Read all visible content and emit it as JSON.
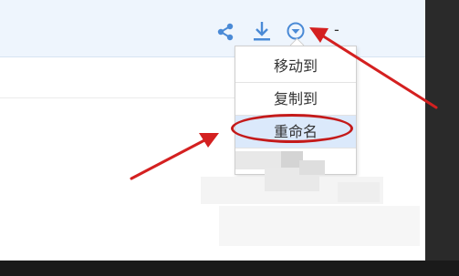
{
  "toolbar": {
    "icons": [
      "share-icon",
      "download-icon",
      "more-dropdown-icon"
    ],
    "trailing_text": "-"
  },
  "context_menu": {
    "items": [
      {
        "label": "移动到"
      },
      {
        "label": "复制到"
      },
      {
        "label": "重命名",
        "highlighted": true
      }
    ]
  },
  "annotations": {
    "arrow_color": "#d42020",
    "highlight_color": "#c41a1a"
  },
  "colors": {
    "toolbar_bg": "#eef5fd",
    "icon_blue": "#4a8ad6",
    "selected_item_bg": "#dbe9fb"
  }
}
